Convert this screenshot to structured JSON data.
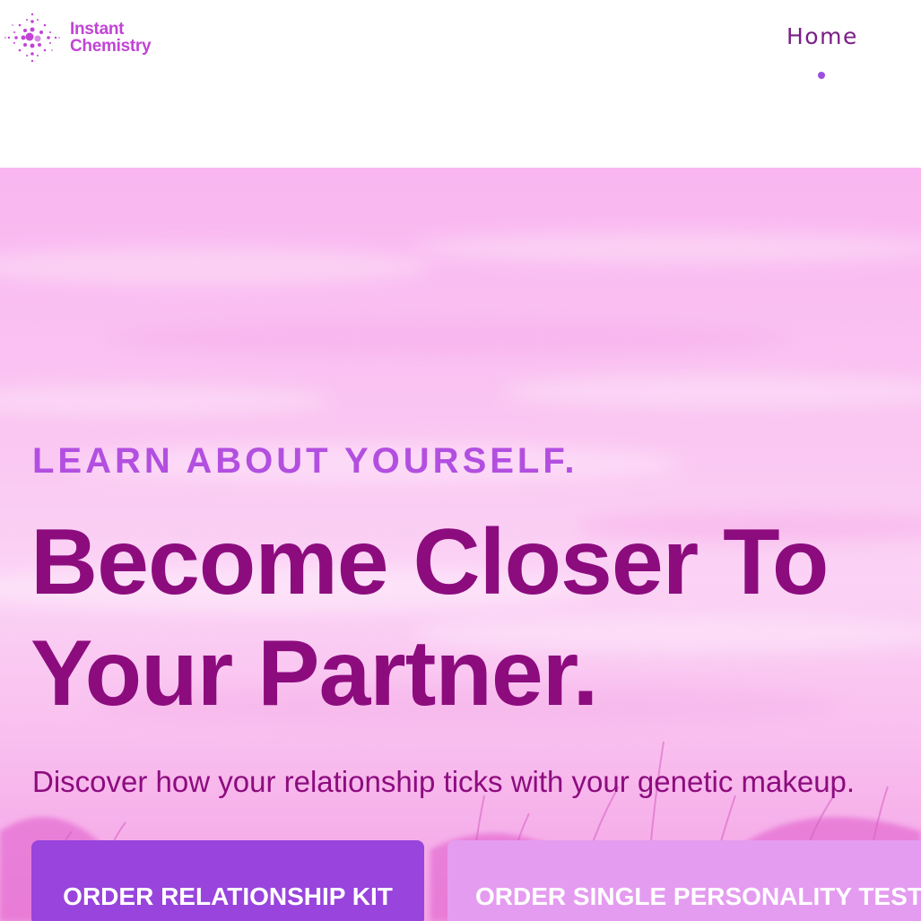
{
  "header": {
    "logo": {
      "line1": "Instant",
      "line2": "Chemistry",
      "icon": "sparkle-molecule-icon",
      "color": "#c244d6"
    },
    "nav": {
      "home_label": "Home",
      "active_indicator_color": "#9b4fe0"
    }
  },
  "hero": {
    "eyebrow": "LEARN ABOUT YOURSELF.",
    "title_line1": "Become Closer To",
    "title_line2": "Your Partner.",
    "subtitle": "Discover how your relationship ticks with your genetic makeup.",
    "buttons": {
      "primary_label": "ORDER RELATIONSHIP KIT",
      "secondary_label": "ORDER SINGLE PERSONALITY TEST"
    },
    "colors": {
      "title": "#8c0c7e",
      "eyebrow": "#b24fe0",
      "primary_button": "#9844dd",
      "secondary_button": "#e49cf0"
    }
  }
}
